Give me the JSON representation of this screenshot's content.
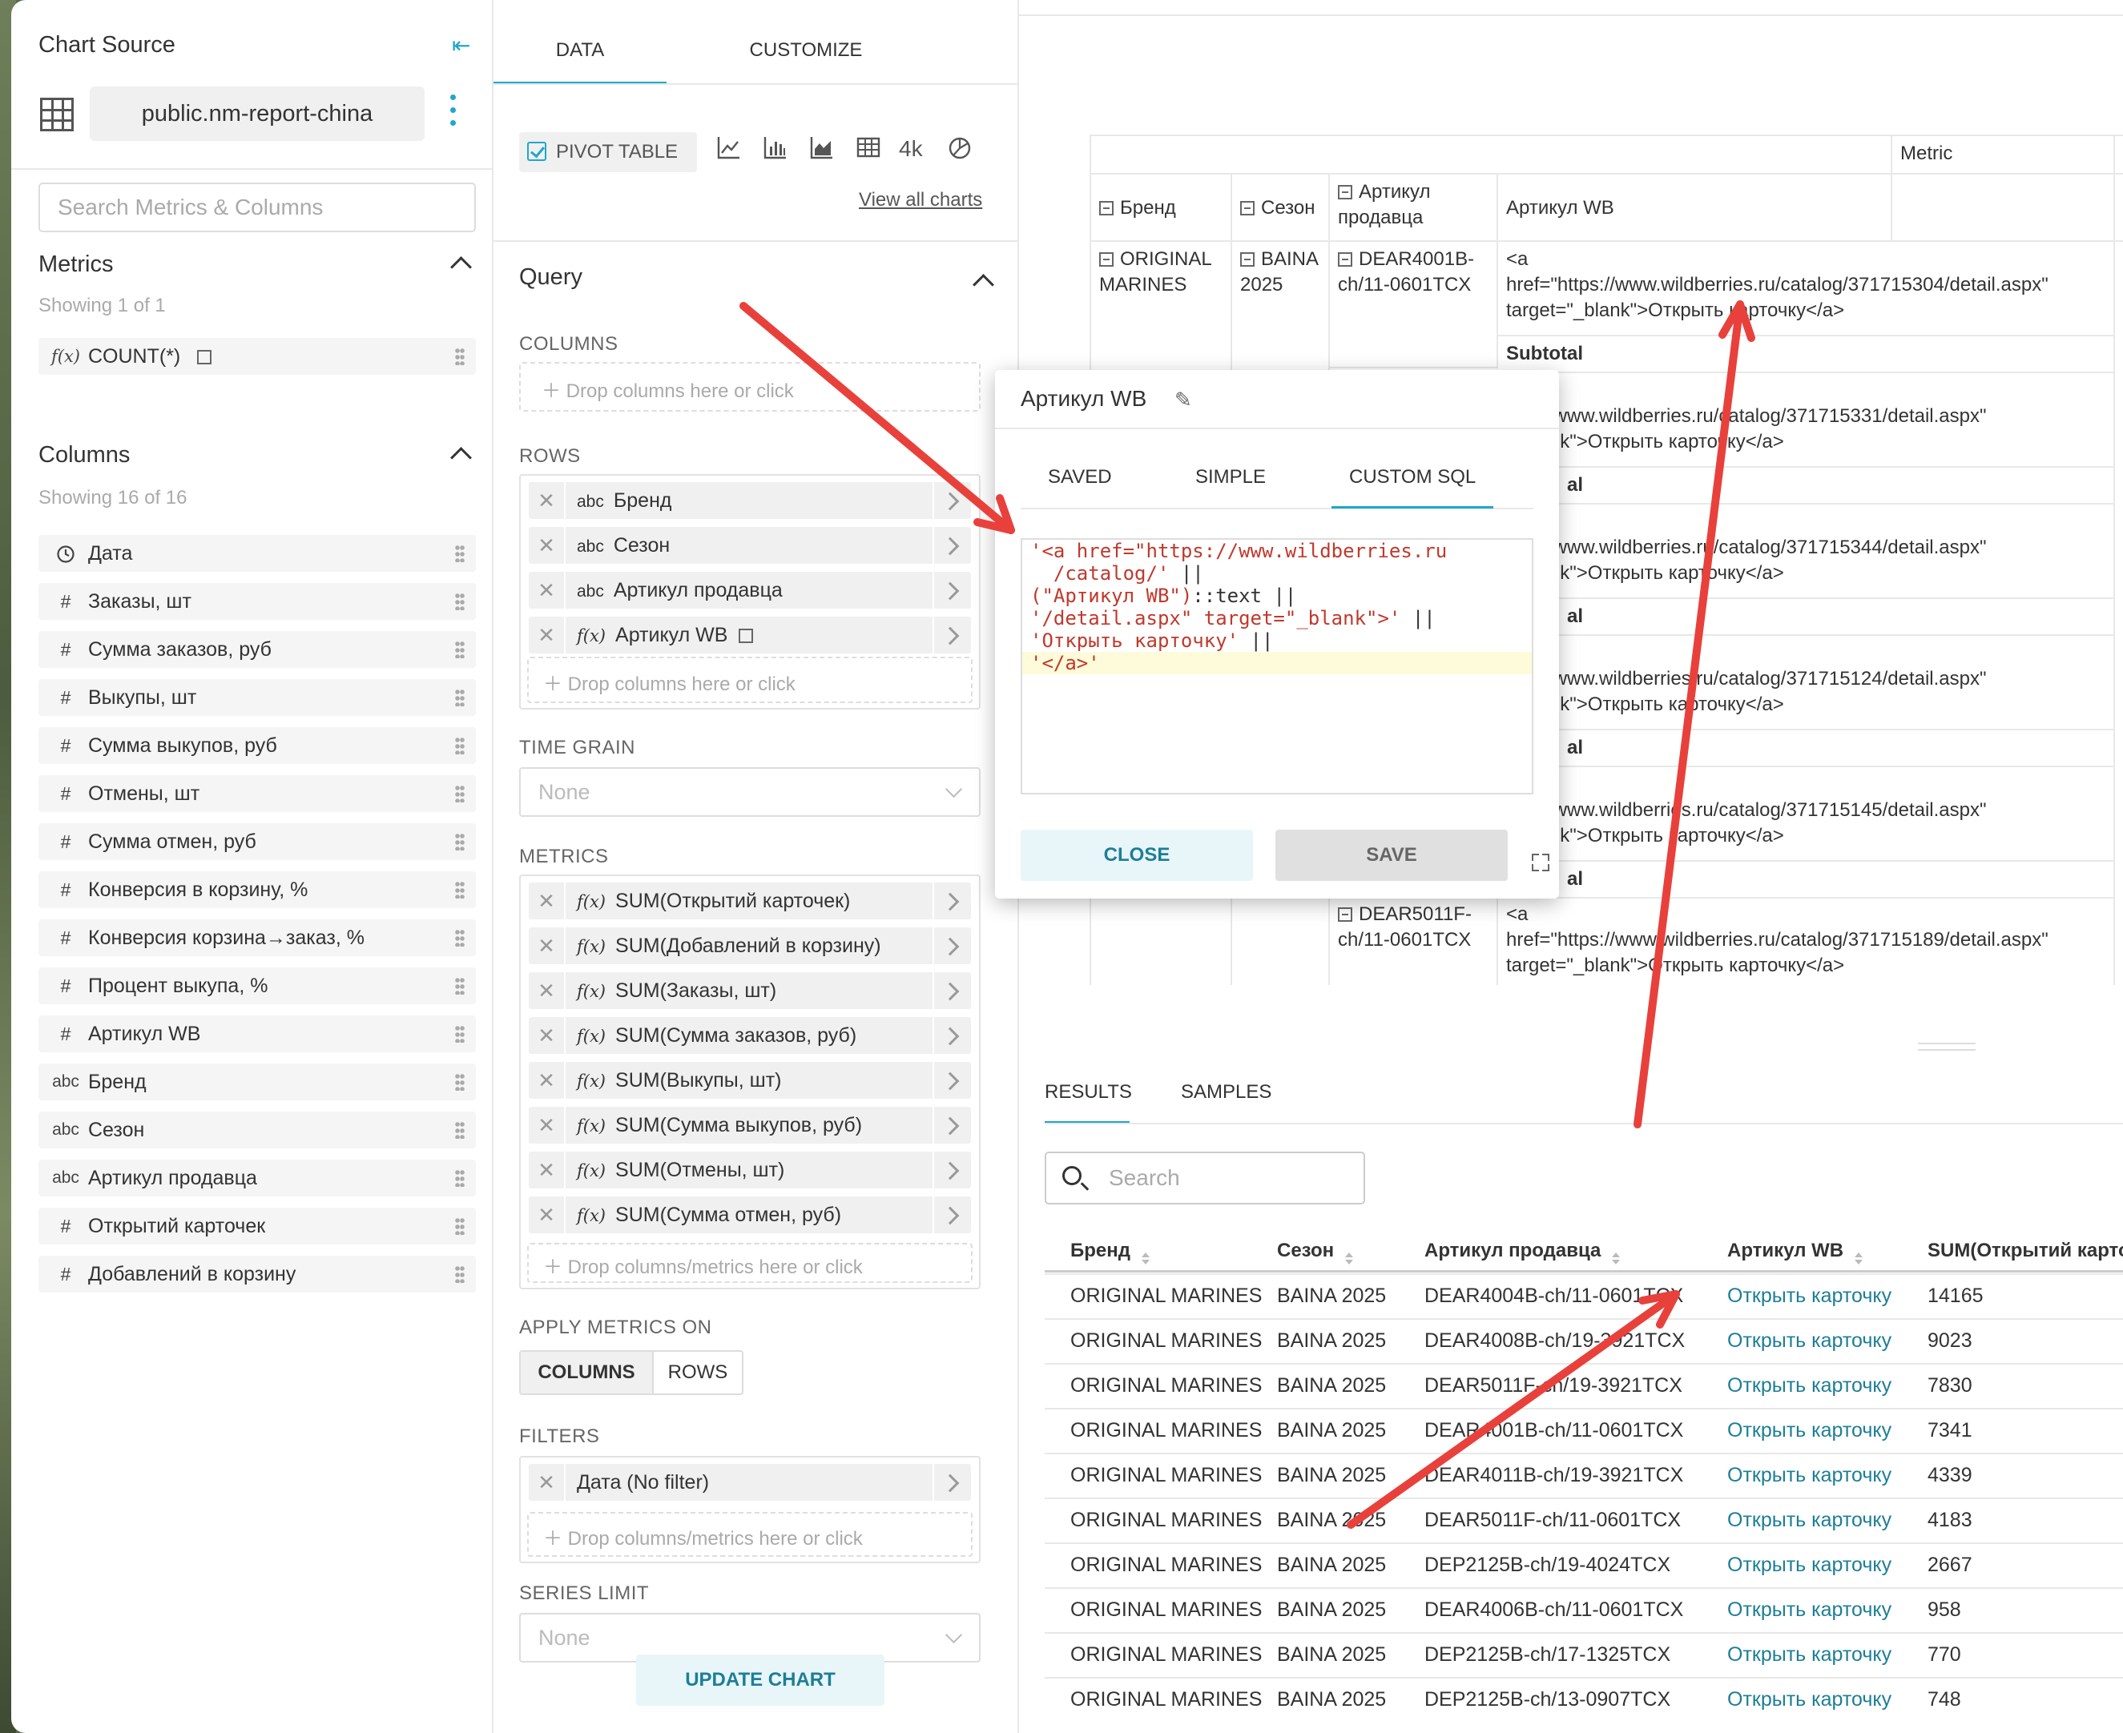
{
  "left_panel": {
    "title": "Chart Source",
    "dataset": "public.nm-report-china",
    "search_placeholder": "Search Metrics & Columns",
    "metrics_header": "Metrics",
    "metrics_showing": "Showing 1 of 1",
    "metrics": [
      {
        "type": "f(x)",
        "label": "COUNT(*)"
      }
    ],
    "columns_header": "Columns",
    "columns_showing": "Showing 16 of 16",
    "columns": [
      {
        "type": "clock",
        "label": "Дата"
      },
      {
        "type": "#",
        "label": "Заказы, шт"
      },
      {
        "type": "#",
        "label": "Сумма заказов, руб"
      },
      {
        "type": "#",
        "label": "Выкупы, шт"
      },
      {
        "type": "#",
        "label": "Сумма выкупов, руб"
      },
      {
        "type": "#",
        "label": "Отмены, шт"
      },
      {
        "type": "#",
        "label": "Сумма отмен, руб"
      },
      {
        "type": "#",
        "label": "Конверсия в корзину, %"
      },
      {
        "type": "#",
        "label": "Конверсия корзина→заказ, %"
      },
      {
        "type": "#",
        "label": "Процент выкупа, %"
      },
      {
        "type": "#",
        "label": "Артикул WB"
      },
      {
        "type": "abc",
        "label": "Бренд"
      },
      {
        "type": "abc",
        "label": "Сезон"
      },
      {
        "type": "abc",
        "label": "Артикул продавца"
      },
      {
        "type": "#",
        "label": "Открытий карточек"
      },
      {
        "type": "#",
        "label": "Добавлений в корзину"
      }
    ]
  },
  "middle_panel": {
    "tabs": [
      "DATA",
      "CUSTOMIZE"
    ],
    "viz_selected": "PIVOT TABLE",
    "viz_big_number": "4k",
    "view_all": "View all charts",
    "query_header": "Query",
    "columns_label": "COLUMNS",
    "columns_drop": "Drop columns here or click",
    "rows_label": "ROWS",
    "rows": [
      {
        "type": "abc",
        "label": "Бренд"
      },
      {
        "type": "abc",
        "label": "Сезон"
      },
      {
        "type": "abc",
        "label": "Артикул продавца"
      },
      {
        "type": "f(x)",
        "label": "Артикул WB"
      }
    ],
    "rows_drop": "Drop columns here or click",
    "time_grain_label": "TIME GRAIN",
    "time_grain_value": "None",
    "metrics_label": "METRICS",
    "metrics": [
      "SUM(Открытий карточек)",
      "SUM(Добавлений в корзину)",
      "SUM(Заказы, шт)",
      "SUM(Сумма заказов, руб)",
      "SUM(Выкупы, шт)",
      "SUM(Сумма выкупов, руб)",
      "SUM(Отмены, шт)",
      "SUM(Сумма отмен, руб)"
    ],
    "metrics_drop": "Drop columns/metrics here or click",
    "apply_label": "APPLY METRICS ON",
    "apply_options": [
      "COLUMNS",
      "ROWS"
    ],
    "filters_label": "FILTERS",
    "filters": [
      "Дата (No filter)"
    ],
    "filters_drop": "Drop columns/metrics here or click",
    "series_limit_label": "SERIES LIMIT",
    "series_limit_value": "None",
    "update_button": "UPDATE CHART"
  },
  "pivot_preview": {
    "metric_header": "Metric",
    "headers": [
      "Бренд",
      "Сезон",
      "Артикул продавца",
      "Артикул WB"
    ],
    "first_row": {
      "brand": "ORIGINAL MARINES",
      "season": "BAINA 2025",
      "seller_article": "DEAR4001B-ch/11-0601TCX"
    },
    "subtotal": "Subtotal",
    "last_article": "DEAR5011F-ch/11-0601TCX",
    "cells": [
      {
        "l1": "<a",
        "l2": "href=\"https://www.wildberries.ru/catalog/371715304/detail.aspx\"",
        "l3": "target=\"_blank\">Открыть карточку</a>"
      },
      {
        "l2": "ttps://www.wildberries.ru/catalog/371715331/detail.aspx\"",
        "l3": "\"_blank\">Открыть карточку</a>"
      },
      {
        "l2": "ttps://www.wildberries.ru/catalog/371715344/detail.aspx\"",
        "l3": "\"_blank\">Открыть карточку</a>"
      },
      {
        "l2": "ttps://www.wildberries.ru/catalog/371715124/detail.aspx\"",
        "l3": "\"_blank\">Открыть карточку</a>"
      },
      {
        "l2": "ttps://www.wildberries.ru/catalog/371715145/detail.aspx\"",
        "l3": "\"_blank\">Открыть карточку</a>"
      },
      {
        "l1": "<a",
        "l2": "href=\"https://www.wildberries.ru/catalog/371715189/detail.aspx\"",
        "l3": "target=\"_blank\">Открыть карточку</a>"
      }
    ],
    "subtotal_frag": "al",
    "edge_frag_1": "S",
    "edge_frag_2": "к"
  },
  "modal": {
    "title": "Артикул WB",
    "tabs": [
      "SAVED",
      "SIMPLE",
      "CUSTOM SQL"
    ],
    "sql_lines": [
      "'<a href=\"https://www.wildberries.ru",
      "  /catalog/'",
      "(\"Артикул WB\")",
      "'/detail.aspx\" target=\"_blank\">'",
      "'Открыть карточку'",
      "'</a>'"
    ],
    "sql_ops": [
      "||",
      "::text ||",
      "||",
      "||"
    ],
    "close": "CLOSE",
    "save": "SAVE"
  },
  "results": {
    "tabs": [
      "RESULTS",
      "SAMPLES"
    ],
    "search_placeholder": "Search",
    "headers": [
      "Бренд",
      "Сезон",
      "Артикул продавца",
      "Артикул WB",
      "SUM(Открытий карто"
    ],
    "rows": [
      [
        "ORIGINAL MARINES",
        "BAINA 2025",
        "DEAR4004B-ch/11-0601TCX",
        "Открыть карточку",
        "14165"
      ],
      [
        "ORIGINAL MARINES",
        "BAINA 2025",
        "DEAR4008B-ch/19-3921TCX",
        "Открыть карточку",
        "9023"
      ],
      [
        "ORIGINAL MARINES",
        "BAINA 2025",
        "DEAR5011F-ch/19-3921TCX",
        "Открыть карточку",
        "7830"
      ],
      [
        "ORIGINAL MARINES",
        "BAINA 2025",
        "DEAR4001B-ch/11-0601TCX",
        "Открыть карточку",
        "7341"
      ],
      [
        "ORIGINAL MARINES",
        "BAINA 2025",
        "DEAR4011B-ch/19-3921TCX",
        "Открыть карточку",
        "4339"
      ],
      [
        "ORIGINAL MARINES",
        "BAINA 2025",
        "DEAR5011F-ch/11-0601TCX",
        "Открыть карточку",
        "4183"
      ],
      [
        "ORIGINAL MARINES",
        "BAINA 2025",
        "DEP2125B-ch/19-4024TCX",
        "Открыть карточку",
        "2667"
      ],
      [
        "ORIGINAL MARINES",
        "BAINA 2025",
        "DEAR4006B-ch/11-0601TCX",
        "Открыть карточку",
        "958"
      ],
      [
        "ORIGINAL MARINES",
        "BAINA 2025",
        "DEP2125B-ch/17-1325TCX",
        "Открыть карточку",
        "770"
      ],
      [
        "ORIGINAL MARINES",
        "BAINA 2025",
        "DEP2125B-ch/13-0907TCX",
        "Открыть карточку",
        "748"
      ]
    ]
  },
  "colors": {
    "accent": "#20a7c9",
    "link": "#1d7e96",
    "annotation_arrow": "#e8413c"
  }
}
